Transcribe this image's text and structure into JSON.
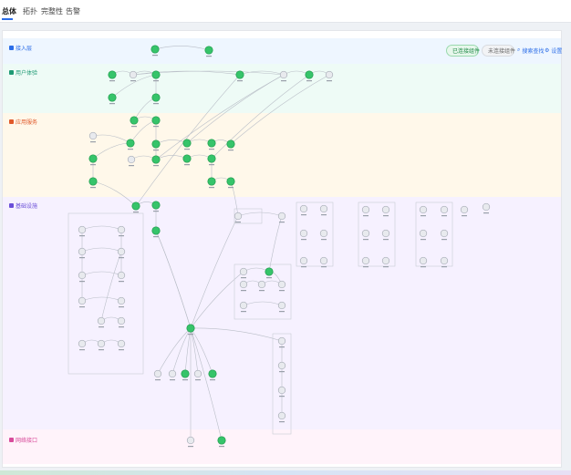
{
  "tabs": [
    {
      "label": "总体"
    },
    {
      "label": "拓扑"
    },
    {
      "label": "完整性"
    },
    {
      "label": "告警"
    }
  ],
  "bands": [
    {
      "label": "接入层",
      "bg": "#eef6ff",
      "color": "#2b6de8"
    },
    {
      "label": "用户体验",
      "bg": "#eefbf6",
      "color": "#1f9a74"
    },
    {
      "label": "应用服务",
      "bg": "#fff8ea",
      "color": "#e0592a"
    },
    {
      "label": "基础设施",
      "bg": "#f6f1ff",
      "color": "#6b4fd8"
    },
    {
      "label": "网络接口",
      "bg": "#fff3fa",
      "color": "#d84c9b"
    }
  ],
  "toolbar": {
    "legend_good": "已连接组件",
    "legend_bad": "未连接组件",
    "search": "搜索查找",
    "settings": "设置"
  },
  "colors": {
    "good": "#36c46a",
    "neutral": "#c8ccd4",
    "accent": "#2b6de8",
    "edge": "#b9bec7"
  }
}
